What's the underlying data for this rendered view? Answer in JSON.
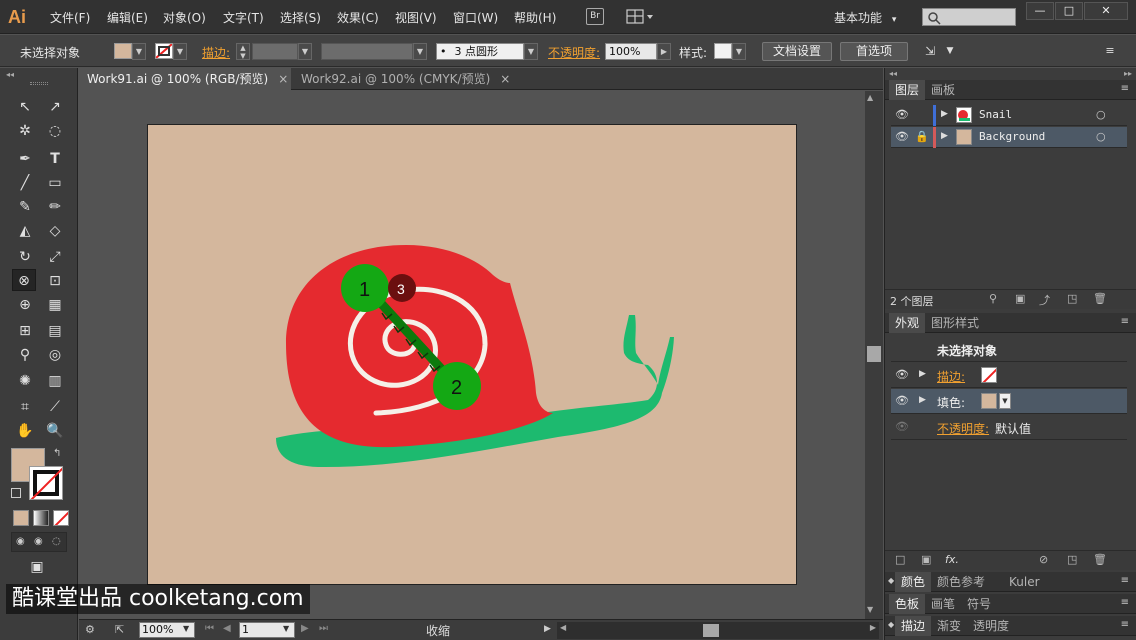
{
  "app": {
    "logo": "Ai",
    "menus": [
      "文件(F)",
      "编辑(E)",
      "对象(O)",
      "文字(T)",
      "选择(S)",
      "效果(C)",
      "视图(V)",
      "窗口(W)",
      "帮助(H)"
    ],
    "bridge_label": "Br",
    "workspace": "基本功能",
    "workspace_arrow": "▾",
    "window_buttons": [
      "—",
      "□",
      "✕"
    ]
  },
  "control_bar": {
    "selection_label": "未选择对象",
    "stroke_label": "描边:",
    "brush_value": "3 点圆形",
    "opacity_label": "不透明度:",
    "opacity_value": "100%",
    "style_label": "样式:",
    "doc_settings_label": "文档设置",
    "preferences_label": "首选项",
    "fill_color": "#d4b79d"
  },
  "tabs": [
    {
      "label": "Work91.ai @ 100% (RGB/预览)",
      "active": true
    },
    {
      "label": "Work92.ai @ 100% (CMYK/预览)",
      "active": false
    }
  ],
  "tab_close": "×",
  "artboard": {
    "background_color": "#d4b79d",
    "shell_color": "#e52a2f",
    "body_color": "#1dba6f",
    "marker_color": "#14a814",
    "markers": [
      {
        "label": "1"
      },
      {
        "label": "2"
      },
      {
        "label": "3"
      }
    ]
  },
  "status_bar": {
    "zoom": "100%",
    "artboard_num": "1",
    "mode": "收缩"
  },
  "layers_panel": {
    "tabs": [
      "图层",
      "画板"
    ],
    "layers": [
      {
        "name": "Snail",
        "color": "#3f6fd8",
        "locked": false,
        "selected": false
      },
      {
        "name": "Background",
        "color": "#d45a5a",
        "locked": true,
        "selected": true
      }
    ],
    "count_label": "2 个图层"
  },
  "appearance_panel": {
    "tabs": [
      "外观",
      "图形样式"
    ],
    "title": "未选择对象",
    "stroke_label": "描边:",
    "fill_label": "填色:",
    "opacity_label": "不透明度:",
    "opacity_value": "默认值",
    "fx_label": "fx."
  },
  "collapsed_panels": [
    [
      "颜色",
      "颜色参考",
      "Kuler"
    ],
    [
      "色板",
      "画笔",
      "符号"
    ],
    [
      "描边",
      "渐变",
      "透明度"
    ]
  ],
  "watermark": "酷课堂出品 coolketang.com"
}
